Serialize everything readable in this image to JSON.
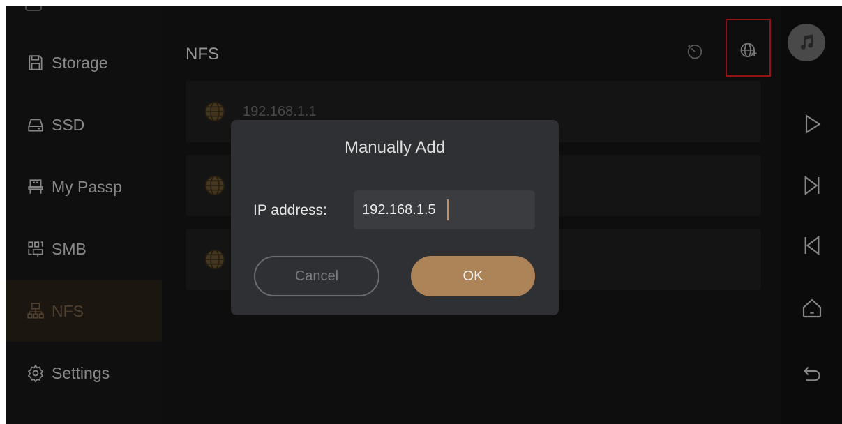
{
  "sidebar": {
    "items": [
      {
        "label": "Storage",
        "icon": "floppy-disk-icon"
      },
      {
        "label": "SSD",
        "icon": "drive-icon"
      },
      {
        "label": "My Passp",
        "icon": "usb-drive-icon"
      },
      {
        "label": "SMB",
        "icon": "network-share-icon"
      },
      {
        "label": "NFS",
        "icon": "network-tree-icon",
        "active": true
      },
      {
        "label": "Settings",
        "icon": "gear-icon"
      }
    ]
  },
  "main": {
    "title": "NFS",
    "header_icons": [
      "refresh-timer-icon",
      "add-network-globe-icon"
    ],
    "servers": [
      {
        "ip": "192.168.1.1",
        "icon": "globe-icon"
      },
      {
        "ip": "",
        "icon": "globe-icon"
      },
      {
        "ip": "",
        "icon": "globe-icon"
      }
    ]
  },
  "dialog": {
    "title": "Manually Add",
    "ip_label": "IP address:",
    "ip_value": "192.168.1.5",
    "cancel_label": "Cancel",
    "ok_label": "OK"
  },
  "right_rail": {
    "icons": [
      "music-note-icon",
      "play-icon",
      "skip-next-icon",
      "skip-previous-icon",
      "home-icon",
      "back-icon"
    ]
  },
  "colors": {
    "accent": "#ad8457",
    "active_sidebar_bg": "#2b2319",
    "highlight": "#e02020"
  }
}
